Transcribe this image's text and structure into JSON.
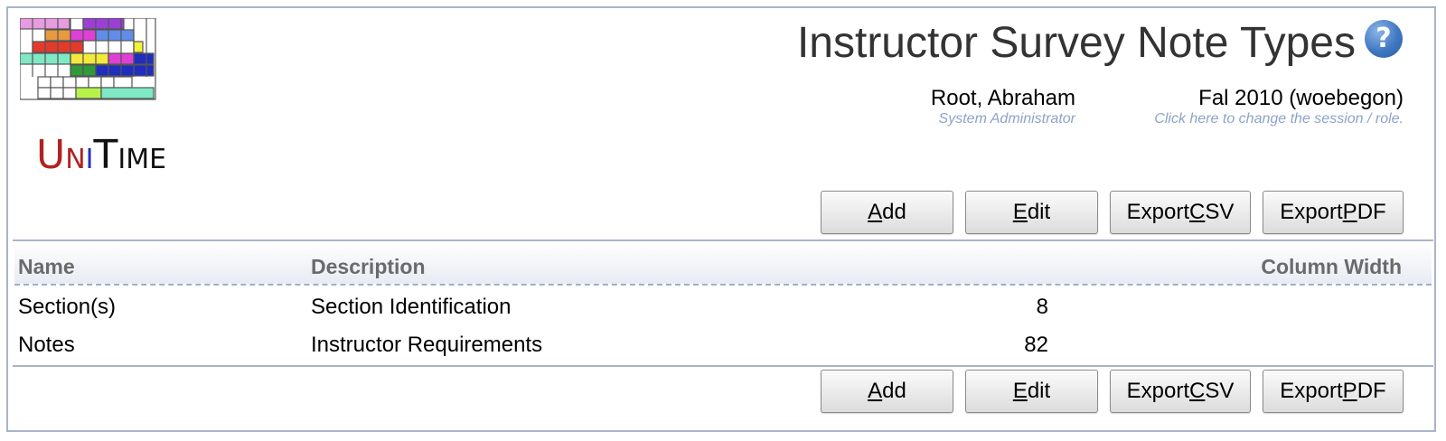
{
  "app": {
    "logo_text": "UniTime",
    "title": "Instructor Survey Note Types",
    "help_symbol": "?"
  },
  "user": {
    "name": "Root, Abraham",
    "role": "System Administrator"
  },
  "session": {
    "name": "Fal 2010 (woebegon)",
    "hint": "Click here to change the session / role."
  },
  "buttons": {
    "add": {
      "pre": "",
      "key": "A",
      "post": "dd"
    },
    "edit": {
      "pre": "",
      "key": "E",
      "post": "dit"
    },
    "export_csv": {
      "pre": "Export ",
      "key": "C",
      "post": "SV"
    },
    "export_pdf": {
      "pre": "Export ",
      "key": "P",
      "post": "DF"
    }
  },
  "table": {
    "columns": {
      "name": "Name",
      "description": "Description",
      "column_width": "Column Width"
    },
    "rows": [
      {
        "name": "Section(s)",
        "description": "Section Identification",
        "column_width": "8"
      },
      {
        "name": "Notes",
        "description": "Instructor Requirements",
        "column_width": "82"
      }
    ]
  },
  "colors": {
    "border": "#a9b4c9",
    "role_text": "#8fa2c8",
    "help_icon": "#3f78c2"
  },
  "icons": {
    "help": "question-mark-circle-icon"
  }
}
